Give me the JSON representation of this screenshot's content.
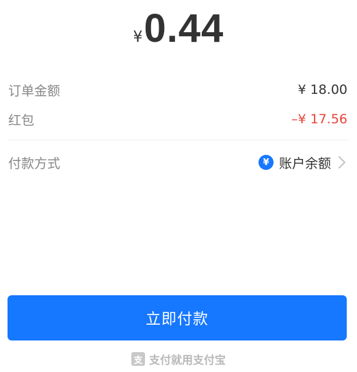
{
  "amount": {
    "currency": "¥",
    "value": "0.44"
  },
  "details": {
    "order_label": "订单金额",
    "order_value": "¥ 18.00",
    "redpacket_label": "红包",
    "redpacket_value": "–¥ 17.56"
  },
  "payment": {
    "label": "付款方式",
    "method_icon_glyph": "¥",
    "method": "账户余额"
  },
  "pay_button_label": "立即付款",
  "footer": {
    "icon_glyph": "支",
    "text": "支付就用支付宝"
  },
  "colors": {
    "brand_blue": "#1677ff",
    "discount_red": "#e8463b"
  }
}
